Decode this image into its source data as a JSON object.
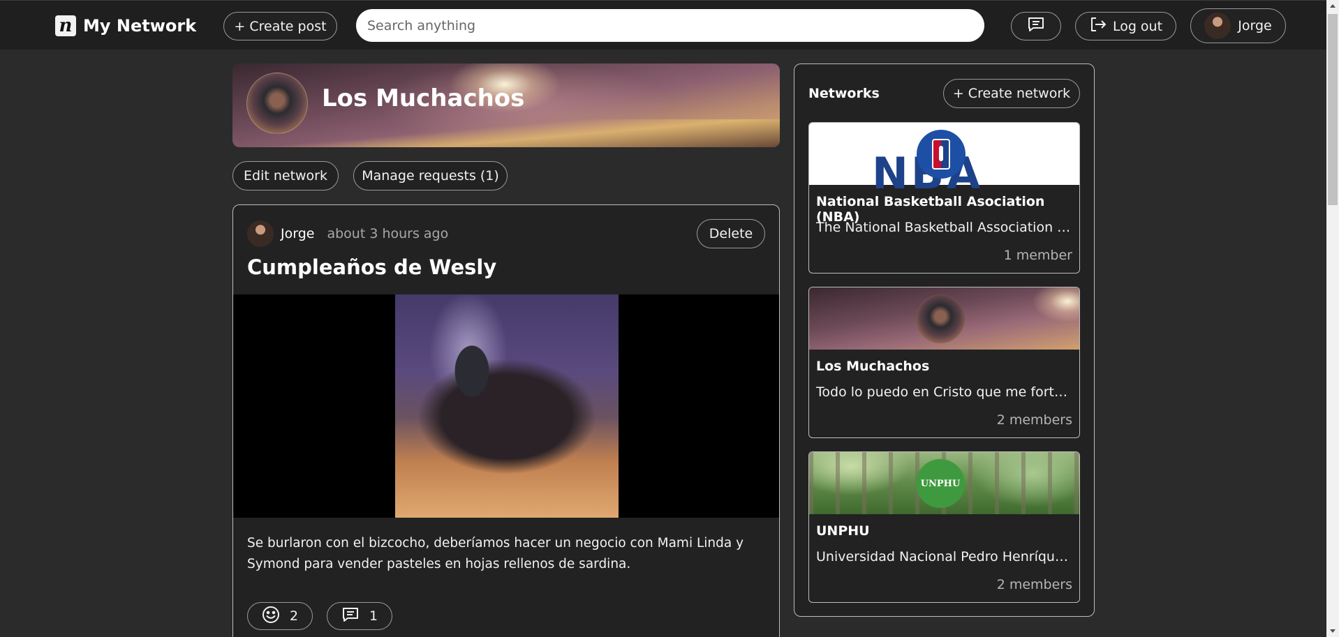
{
  "app": {
    "logo_letter": "n",
    "title": "My Network"
  },
  "topbar": {
    "create_post_label": "+ Create post",
    "search_placeholder": "Search anything",
    "logout_label": "Log out",
    "user_name": "Jorge"
  },
  "network": {
    "name": "Los Muchachos",
    "edit_label": "Edit network",
    "manage_requests_label": "Manage requests (1)"
  },
  "post": {
    "author": "Jorge",
    "time": "about 3 hours ago",
    "delete_label": "Delete",
    "title": "Cumpleaños de Wesly",
    "body": "Se burlaron con el bizcocho, deberíamos hacer un negocio con Mami Linda y Symond para vender pasteles en hojas rellenos de sardina.",
    "reactions_count": "2",
    "comments_count": "1"
  },
  "sidebar": {
    "title": "Networks",
    "create_network_label": "+ Create network",
    "networks": [
      {
        "name": "National Basketball Asociation (NBA)",
        "description": "The National Basketball Association is a...",
        "members": "1 member",
        "banner_text": "NBA"
      },
      {
        "name": "Los Muchachos",
        "description": "Todo lo puedo en Cristo que me fortale...",
        "members": "2 members"
      },
      {
        "name": "UNPHU",
        "description": "Universidad Nacional Pedro Henríquez ...",
        "members": "2 members",
        "badge_text": "UNPHU"
      }
    ]
  },
  "colors": {
    "background": "#2b2b2b",
    "topbar": "#1f1f1f",
    "card": "#222222",
    "border": "#bdbdbd",
    "muted_text": "#a8a8a8",
    "nba_blue": "#1d428a",
    "nba_red": "#c8102e",
    "unphu_green": "#3f9a3f"
  },
  "icons": {
    "chat": "chat-bubble-icon",
    "logout": "logout-icon",
    "react": "smiley-icon",
    "comment": "comment-icon"
  }
}
